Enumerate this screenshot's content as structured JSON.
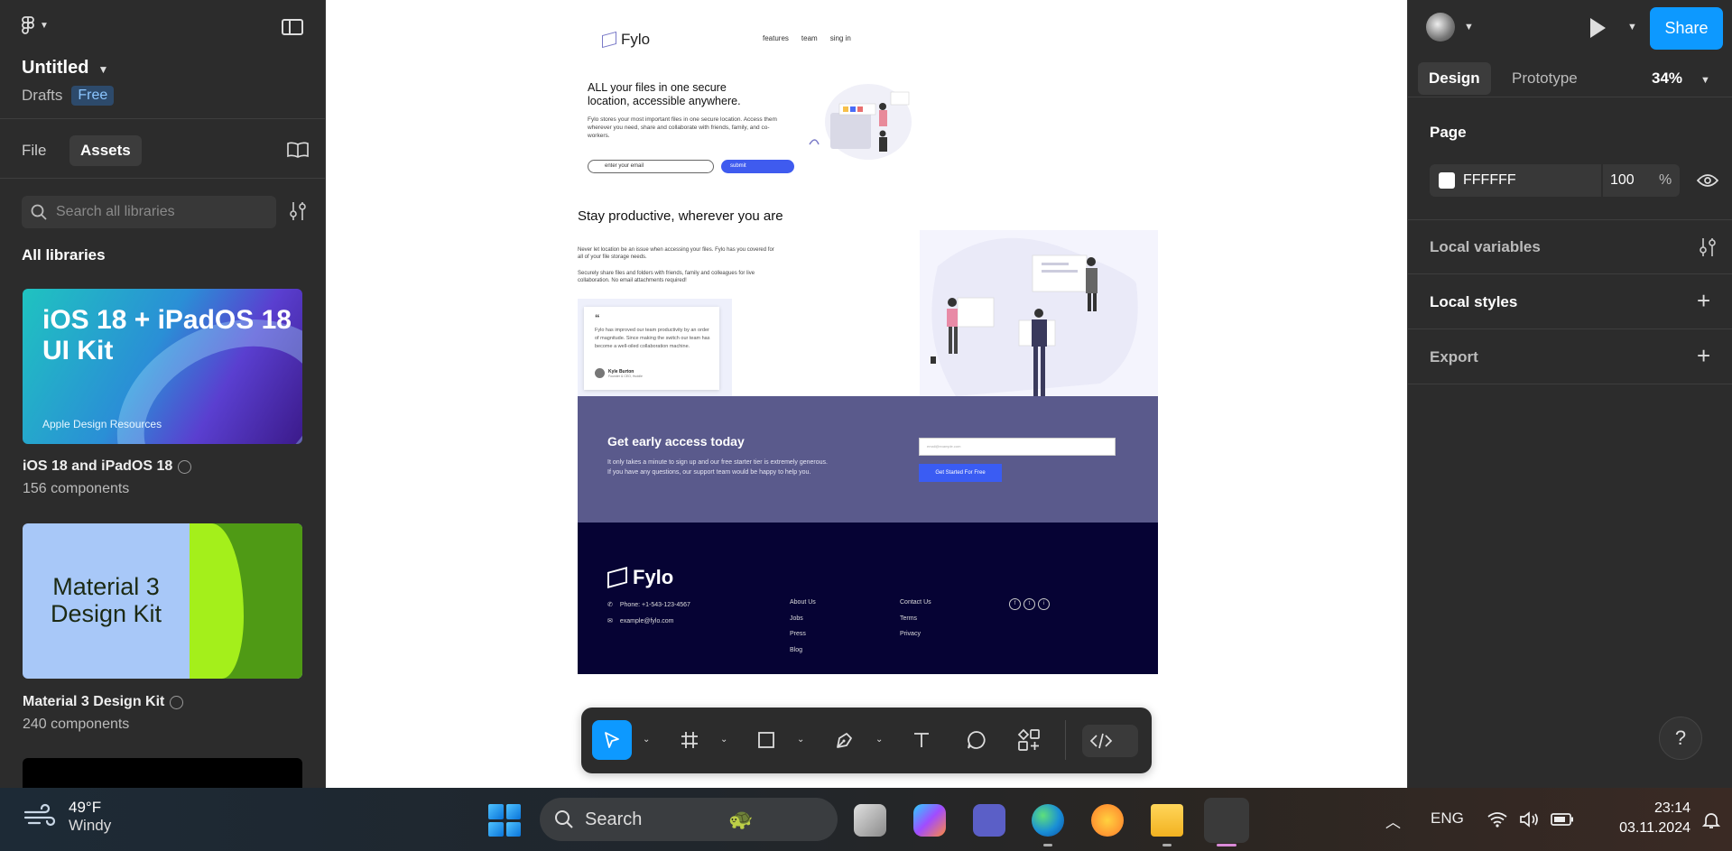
{
  "left_panel": {
    "file_title": "Untitled",
    "location": "Drafts",
    "plan_badge": "Free",
    "tabs": {
      "file": "File",
      "assets": "Assets"
    },
    "search_placeholder": "Search all libraries",
    "section_title": "All libraries",
    "libraries": [
      {
        "card_title": "iOS 18 + iPadOS 18 UI Kit",
        "card_footer": "Apple Design Resources",
        "name": "iOS 18 and iPadOS 18",
        "count": "156 components"
      },
      {
        "card_title": "Material 3 Design Kit",
        "name": "Material 3 Design Kit",
        "count": "240 components"
      }
    ]
  },
  "canvas": {
    "site": {
      "logo": "Fylo",
      "nav": [
        "features",
        "team",
        "sing in"
      ],
      "hero_heading": "ALL your files in one secure location, accessible anywhere.",
      "hero_text": "Fylo stores your most important files in one secure location. Access them wherever you need, share and collaborate with friends, family, and co-workers.",
      "email_placeholder": "enter your email",
      "submit_label": "submit",
      "section2_heading": "Stay productive, wherever you are",
      "section2_p1": "Never let location be an issue when accessing your files. Fylo has you covered for all of your file storage needs.",
      "section2_p2": "Securely share files and folders with friends, family and colleagues for live collaboration. No email attachments required!",
      "testimonial": {
        "quote_mark": "“",
        "text": "Fylo has improved our team productivity by an order of magnitude. Since making the switch our team has become a well-oiled collaboration machine.",
        "name": "Kyle Burton",
        "role": "Founder & CEO, Huddle"
      },
      "cta_heading": "Get early access today",
      "cta_text": "It only takes a minute to sign up and our free starter tier is extremely generous. If you have any questions, our support team would be happy to help you.",
      "cta_input_placeholder": "email@example.com",
      "cta_button": "Get Started For Free",
      "footer_logo": "Fylo",
      "footer_phone": "Phone: +1-543-123-4567",
      "footer_email": "example@fylo.com",
      "footer_col1": [
        "About Us",
        "Jobs",
        "Press",
        "Blog"
      ],
      "footer_col2": [
        "Contact Us",
        "Terms",
        "Privacy"
      ],
      "social": [
        "f",
        "t",
        "i"
      ]
    }
  },
  "right_panel": {
    "share_label": "Share",
    "tabs": {
      "design": "Design",
      "prototype": "Prototype"
    },
    "zoom": "34%",
    "page_heading": "Page",
    "page_color": "FFFFFF",
    "page_opacity": "100",
    "percent": "%",
    "local_variables": "Local variables",
    "local_styles": "Local styles",
    "export": "Export",
    "help": "?"
  },
  "taskbar": {
    "temperature": "49°F",
    "condition": "Windy",
    "search_label": "Search",
    "language": "ENG",
    "time": "23:14",
    "date": "03.11.2024"
  },
  "colors": {
    "accent": "#0d99ff",
    "panel_bg": "#2c2c2c",
    "cta_bg": "#5a5a8c",
    "footer_bg": "#060334"
  }
}
